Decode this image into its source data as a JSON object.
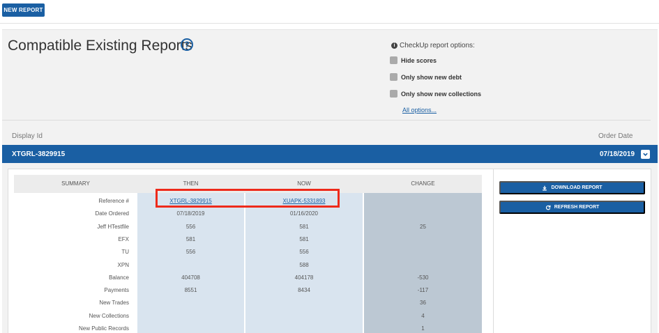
{
  "toolbar": {
    "new_report_label": "NEW REPORT"
  },
  "page": {
    "title": "Compatible Existing Reports",
    "help_glyph": "?"
  },
  "options": {
    "header": "CheckUp report options:",
    "info_glyph": "i",
    "items": [
      "Hide scores",
      "Only show new debt",
      "Only show new collections"
    ],
    "all_options_link": "All options..."
  },
  "list": {
    "col_display_id": "Display Id",
    "col_order_date": "Order Date",
    "row": {
      "display_id": "XTGRL-3829915",
      "order_date": "07/18/2019"
    }
  },
  "comparison": {
    "headers": {
      "summary": "SUMMARY",
      "then": "THEN",
      "now": "NOW",
      "change": "CHANGE"
    },
    "rows": [
      {
        "label": "Reference #",
        "then": "XTGRL-3829915",
        "now": "XUAPK-5331893",
        "change": ""
      },
      {
        "label": "Date Ordered",
        "then": "07/18/2019",
        "now": "01/16/2020",
        "change": ""
      },
      {
        "label": "Jeff HTestfile",
        "then": "556",
        "now": "581",
        "change": "25"
      },
      {
        "label": "EFX",
        "then": "581",
        "now": "581",
        "change": ""
      },
      {
        "label": "TU",
        "then": "556",
        "now": "556",
        "change": ""
      },
      {
        "label": "XPN",
        "then": "",
        "now": "588",
        "change": ""
      },
      {
        "label": "Balance",
        "then": "404708",
        "now": "404178",
        "change": "-530"
      },
      {
        "label": "Payments",
        "then": "8551",
        "now": "8434",
        "change": "-117"
      },
      {
        "label": "New Trades",
        "then": "",
        "now": "",
        "change": "36"
      },
      {
        "label": "New Collections",
        "then": "",
        "now": "",
        "change": "4"
      },
      {
        "label": "New Public Records",
        "then": "",
        "now": "",
        "change": "1"
      }
    ]
  },
  "actions": {
    "download_label": "DOWNLOAD REPORT",
    "refresh_label": "REFRESH REPORT"
  },
  "colors": {
    "primary": "#1a5fa3",
    "then_col": "#d9e4ef",
    "now_col": "#d9e4ef",
    "change_col": "#bcc8d3",
    "highlight": "#ee2a1b"
  }
}
